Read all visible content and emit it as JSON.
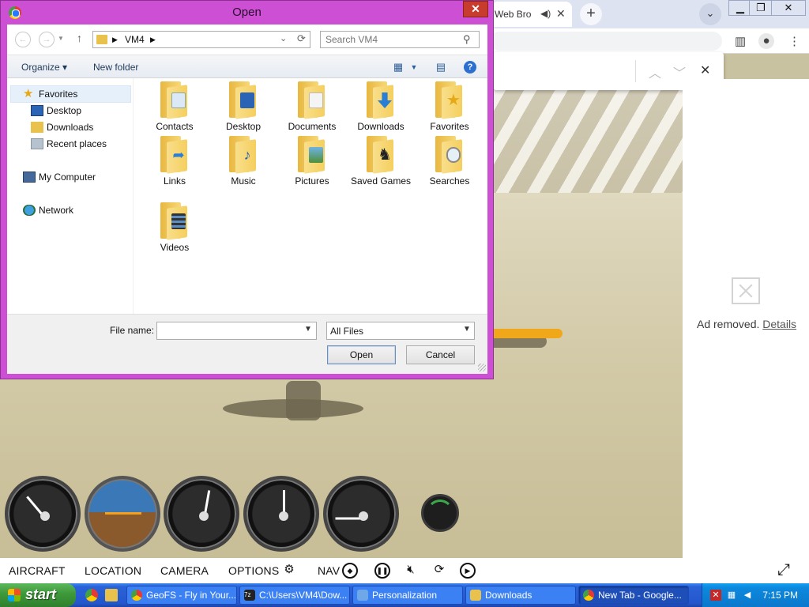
{
  "browser": {
    "tab_title": "Web Bro",
    "speaker_icon": "speaker-icon",
    "new_tab_icon": "plus-icon",
    "findbar": {
      "prev_icon": "chevron-up-icon",
      "next_icon": "chevron-down-icon",
      "close_icon": "close-icon"
    }
  },
  "ad": {
    "text": "Ad removed.",
    "link": "Details"
  },
  "geofs_menu": {
    "aircraft": "AIRCRAFT",
    "location": "LOCATION",
    "camera": "CAMERA",
    "options": "OPTIONS",
    "nav": "NAV"
  },
  "dialog": {
    "title": "Open",
    "path": "VM4",
    "search_placeholder": "Search VM4",
    "organize": "Organize",
    "new_folder": "New folder",
    "nav_pane": {
      "favorites": "Favorites",
      "desktop": "Desktop",
      "downloads": "Downloads",
      "recent_places": "Recent places",
      "my_computer": "My Computer",
      "network": "Network"
    },
    "files": [
      "Contacts",
      "Desktop",
      "Documents",
      "Downloads",
      "Favorites",
      "Links",
      "Music",
      "Pictures",
      "Saved Games",
      "Searches",
      "Videos"
    ],
    "file_name_label": "File name:",
    "file_name_value": "",
    "file_type": "All Files",
    "open_button": "Open",
    "cancel_button": "Cancel"
  },
  "taskbar": {
    "start": "start",
    "tasks": [
      "GeoFS - Fly in Your...",
      "C:\\Users\\VM4\\Dow...",
      "Personalization",
      "Downloads",
      "New Tab - Google..."
    ],
    "clock": "7:15 PM"
  },
  "colors": {
    "dialog_frame": "#cc4fd4",
    "taskbar": "#2456cc",
    "start_green": "#3f9b3b",
    "folder_yellow": "#f5cf5e"
  }
}
